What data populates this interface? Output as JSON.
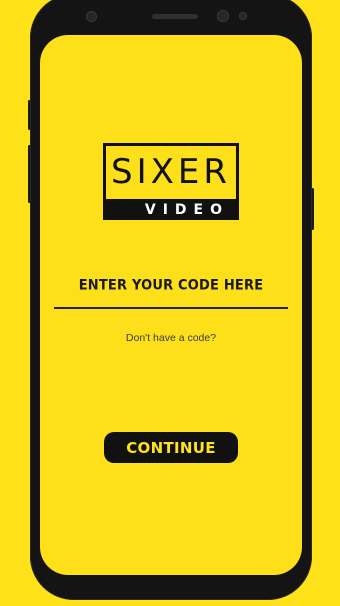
{
  "logo": {
    "top_text": "SIXER",
    "bottom_text": "VIDEO"
  },
  "code_entry": {
    "label": "ENTER YOUR CODE HERE",
    "value": ""
  },
  "no_code_link": "Don't have a code?",
  "continue_button": "CONTINUE",
  "colors": {
    "background": "#ffe21a",
    "text": "#111111"
  }
}
